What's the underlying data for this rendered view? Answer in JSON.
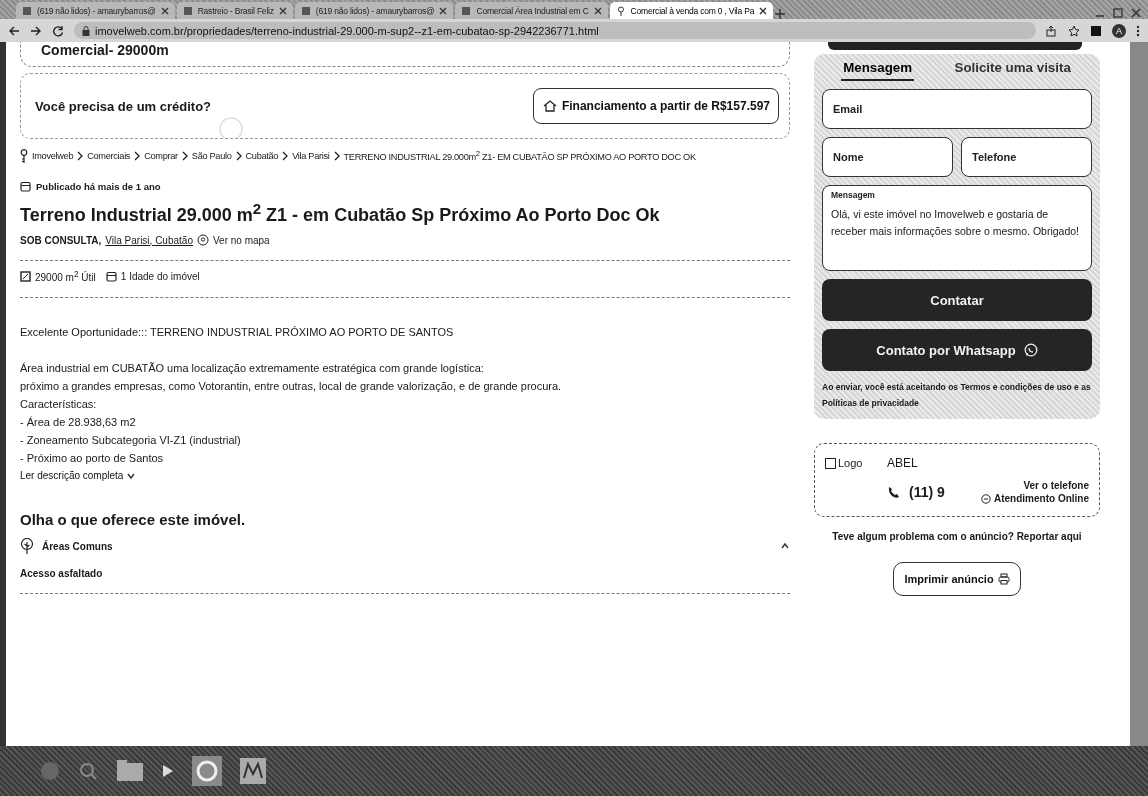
{
  "browser": {
    "tabs": [
      {
        "title": "(619 não lidos) - amaurybarros@",
        "selected": false
      },
      {
        "title": "Rastreio - Brasil Feliz",
        "selected": false
      },
      {
        "title": "(619 não lidos) - amaurybarros@",
        "selected": false
      },
      {
        "title": "Comercial Área Industrial em C",
        "selected": false
      },
      {
        "title": "Comercial à venda com 0 , Vila Pa",
        "selected": true
      }
    ],
    "url": "imovelweb.com.br/propriedades/terreno-industrial-29.000-m-sup2--z1-em-cubatao-sp-2942236771.html",
    "avatar": "A"
  },
  "credit_banner": {
    "cut_title": "Comercial- 29000m",
    "question": "Você precisa de um crédito?",
    "button": "Financiamento a partir de R$157.597"
  },
  "breadcrumb": [
    "Imovelweb",
    "Comerciais",
    "Comprar",
    "São Paulo",
    "Cubatão",
    "Vila Parisi",
    "TERRENO INDUSTRIAL 29.000m$^{2}$ Z1- EM CUBATÃO SP PRÓXIMO AO PORTO DOC OK"
  ],
  "published": "Publicado há mais de 1 ano",
  "title": "Terreno Industrial 29.000 m$^{2}$ Z1 - em Cubatão Sp Próximo Ao Porto Doc Ok",
  "location": {
    "price": "SOB CONSULTA,",
    "address": "Vila Parisi, Cubatão",
    "map_link": "Ver no mapa"
  },
  "features": [
    {
      "kind": "area",
      "text": "29000 m$^{2}$ Útil"
    },
    {
      "kind": "age",
      "text": "1 Idade do imóvel"
    }
  ],
  "description": {
    "intro": "Excelente Oportunidade::: TERRENO INDUSTRIAL PRÓXIMO AO PORTO DE SANTOS",
    "lines": [
      "Área industrial em CUBATÃO uma localização extremamente estratégica com grande logística:",
      "próximo a grandes empresas, como Votorantin, entre outras, local de grande valorização, e de grande procura.",
      "Características:",
      "- Área de 28.938,63 m2",
      "- Zoneamento Subcategoria VI-Z1 (industrial)",
      "- Próximo ao porto de Santos"
    ],
    "more": "Ler descrição completa"
  },
  "amenities": {
    "heading": "Olha o que oferece este imóvel.",
    "group": "Áreas Comuns",
    "expanded": true,
    "items": [
      "Acesso asfaltado"
    ]
  },
  "contact_form": {
    "tabs": [
      {
        "label": "Mensagem",
        "selected": true
      },
      {
        "label": "Solicite uma visita",
        "selected": false
      }
    ],
    "email": {
      "placeholder": "Email"
    },
    "name": {
      "placeholder": "Nome"
    },
    "phone": {
      "placeholder": "Telefone"
    },
    "message": {
      "label": "Mensagem",
      "value": "Olá, vi este imóvel no Imovelweb e gostaria de receber mais informações sobre o mesmo. Obrigado!"
    },
    "buttons": [
      {
        "kind": "plain",
        "label": "Contatar"
      },
      {
        "kind": "whatsapp",
        "label": "Contato por Whatsapp"
      }
    ],
    "terms": "Ao enviar, você está aceitando os Termos e condições de uso e as Políticas de privacidade"
  },
  "advertiser": {
    "logo": "Logo",
    "name": "ABEL",
    "phone": "(11) 9",
    "see_phone": "Ver o telefone",
    "online": "Atendimento Online"
  },
  "report": "Teve algum problema com o anúncio? Reportar aqui",
  "print_button": "Imprimir anúncio"
}
